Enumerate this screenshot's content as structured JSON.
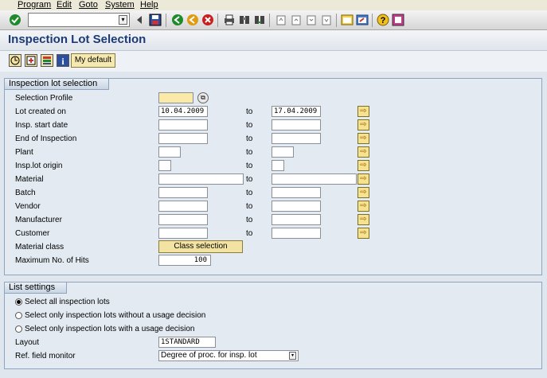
{
  "menu": [
    "Program",
    "Edit",
    "Goto",
    "System",
    "Help"
  ],
  "toolbar": {
    "command_value": "",
    "icons": [
      "enter-icon",
      "back-icon",
      "save-icon",
      "exit-icon",
      "cancel-icon",
      "print-icon",
      "find-icon",
      "find-next-icon",
      "first-page-icon",
      "previous-page-icon",
      "next-page-icon",
      "last-page-icon",
      "create-session-icon",
      "shortcut-icon",
      "help-icon",
      "customize-layout-icon"
    ]
  },
  "title": "Inspection Lot Selection",
  "app_toolbar": {
    "icons": [
      "execute-icon",
      "get-variant-icon",
      "selection-options-icon",
      "info-icon"
    ],
    "my_default": "My default"
  },
  "selection": {
    "title": "Inspection lot selection",
    "to_label": "to",
    "rows": [
      {
        "label": "Selection Profile",
        "from": "",
        "to": ""
      },
      {
        "label": "Lot created on",
        "from": "10.04.2009",
        "to": "17.04.2009"
      },
      {
        "label": "Insp. start date",
        "from": "",
        "to": ""
      },
      {
        "label": "End of Inspection",
        "from": "",
        "to": ""
      },
      {
        "label": "Plant",
        "from": "",
        "to": ""
      },
      {
        "label": "Insp.lot origin",
        "from": "",
        "to": ""
      },
      {
        "label": "Material",
        "from": "",
        "to": ""
      },
      {
        "label": "Batch",
        "from": "",
        "to": ""
      },
      {
        "label": "Vendor",
        "from": "",
        "to": ""
      },
      {
        "label": "Manufacturer",
        "from": "",
        "to": ""
      },
      {
        "label": "Customer",
        "from": "",
        "to": ""
      },
      {
        "label": "Material class",
        "from": "",
        "to": ""
      },
      {
        "label": "Maximum No. of Hits",
        "from": "100",
        "to": ""
      }
    ],
    "class_button": "Class selection"
  },
  "list_settings": {
    "title": "List settings",
    "options": [
      {
        "label": "Select all inspection lots",
        "selected": true
      },
      {
        "label": "Select only inspection lots without a usage decision",
        "selected": false
      },
      {
        "label": "Select only inspection lots with a usage decision",
        "selected": false
      }
    ],
    "layout_label": "Layout",
    "layout_value": "1STANDARD",
    "ref_label": "Ref. field monitor",
    "ref_value": "Degree of proc. for insp. lot"
  },
  "colors": {
    "accent": "#1c3a73",
    "group_bg": "#e3eaf2",
    "required": "#fbe9a7"
  }
}
